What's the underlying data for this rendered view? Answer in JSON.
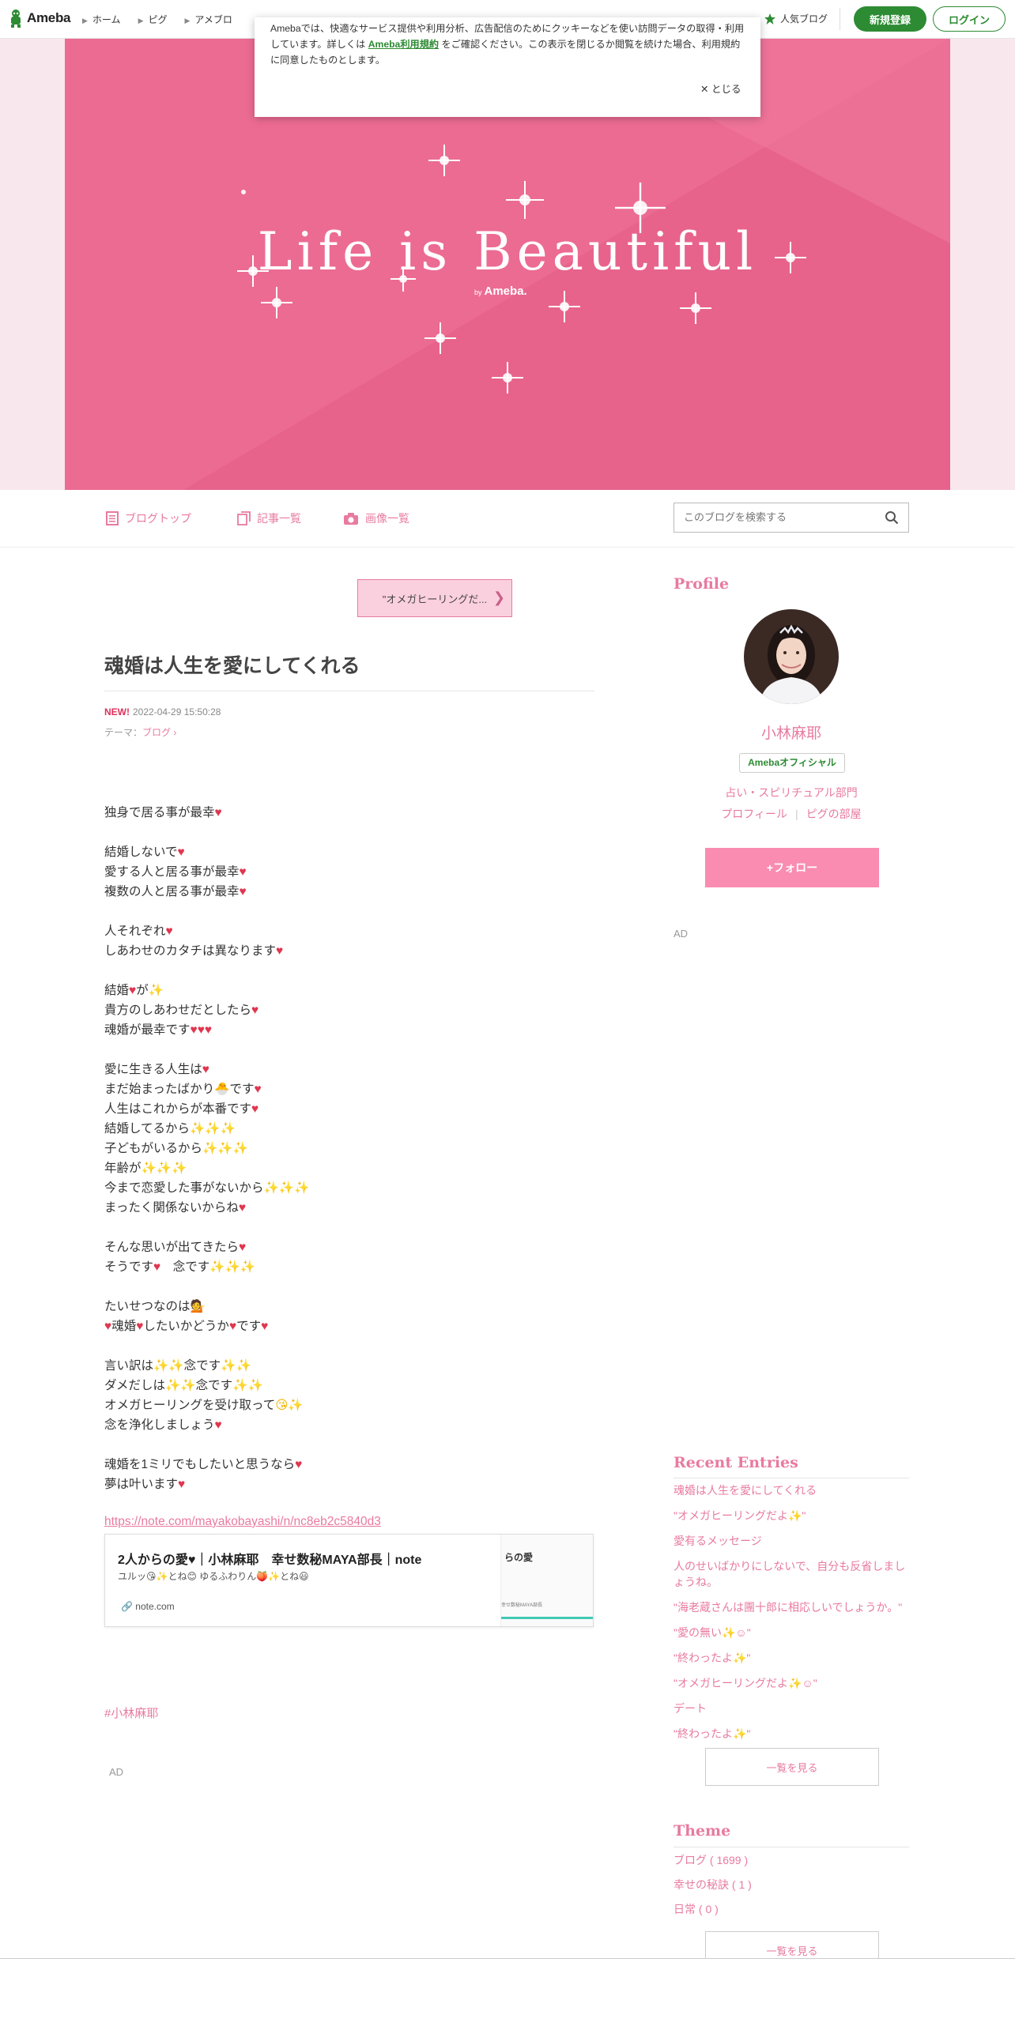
{
  "header": {
    "logo": "Ameba",
    "nav": [
      "ホーム",
      "ピグ",
      "アメブロ"
    ],
    "popular": "人気ブログ",
    "register": "新規登録",
    "login": "ログイン"
  },
  "cookie": {
    "text_before": "Amebaでは、快適なサービス提供や利用分析、広告配信のためにクッキーなどを使い訪問データの取得・利用しています。詳しくは ",
    "link": "Ameba利用規約",
    "text_after": " をご確認ください。この表示を閉じるか閲覧を続けた場合、利用規約に同意したものとします。",
    "close": "とじる"
  },
  "banner": {
    "title": "Life is Beautiful",
    "by": "by",
    "brand": "Ameba."
  },
  "subnav": {
    "blog_top": "ブログトップ",
    "entries": "記事一覧",
    "images": "画像一覧",
    "search_placeholder": "このブログを検索する"
  },
  "article": {
    "prev": "\"オメガヒーリングだ...",
    "title": "魂婚は人生を愛にしてくれる",
    "new": "NEW!",
    "date": "2022-04-29 15:50:28",
    "theme_label": "テーマ：",
    "theme": "ブログ",
    "lines": [
      [
        [
          "t",
          "独身で居る事が最幸"
        ],
        [
          "h",
          "♥"
        ]
      ],
      [],
      [
        [
          "t",
          "結婚しないで"
        ],
        [
          "h",
          "♥"
        ]
      ],
      [
        [
          "t",
          "愛する人と居る事が最幸"
        ],
        [
          "h",
          "♥"
        ]
      ],
      [
        [
          "t",
          "複数の人と居る事が最幸"
        ],
        [
          "h",
          "♥"
        ]
      ],
      [],
      [
        [
          "t",
          "人それぞれ"
        ],
        [
          "h",
          "♥"
        ]
      ],
      [
        [
          "t",
          "しあわせのカタチは異なります"
        ],
        [
          "h",
          "♥"
        ]
      ],
      [],
      [
        [
          "t",
          "結婚"
        ],
        [
          "h",
          "♥"
        ],
        [
          "t",
          "が"
        ],
        [
          "s",
          "✨"
        ]
      ],
      [
        [
          "t",
          "貴方のしあわせだとしたら"
        ],
        [
          "h",
          "♥"
        ]
      ],
      [
        [
          "t",
          "魂婚が最幸です"
        ],
        [
          "h",
          "♥♥♥"
        ]
      ],
      [],
      [
        [
          "t",
          "愛に生きる人生は"
        ],
        [
          "h",
          "♥"
        ]
      ],
      [
        [
          "t",
          "まだ始まったばかり"
        ],
        [
          "s",
          "🐣"
        ],
        [
          "t",
          "です"
        ],
        [
          "h",
          "♥"
        ]
      ],
      [
        [
          "t",
          "人生はこれからが本番です"
        ],
        [
          "h",
          "♥"
        ]
      ],
      [
        [
          "t",
          "結婚してるから"
        ],
        [
          "s",
          "✨✨✨"
        ]
      ],
      [
        [
          "t",
          "子どもがいるから"
        ],
        [
          "s",
          "✨✨✨"
        ]
      ],
      [
        [
          "t",
          "年齢が"
        ],
        [
          "s",
          "✨✨✨"
        ]
      ],
      [
        [
          "t",
          "今まで恋愛した事がないから"
        ],
        [
          "s",
          "✨✨✨"
        ]
      ],
      [
        [
          "t",
          "まったく関係ないからね"
        ],
        [
          "h",
          "♥"
        ]
      ],
      [],
      [
        [
          "t",
          "そんな思いが出てきたら"
        ],
        [
          "h",
          "♥"
        ]
      ],
      [
        [
          "t",
          "そうです"
        ],
        [
          "h",
          "♥"
        ],
        [
          "t",
          "　念です"
        ],
        [
          "s",
          "✨✨✨"
        ]
      ],
      [],
      [
        [
          "t",
          "たいせつなのは"
        ],
        [
          "s",
          "💁"
        ]
      ],
      [
        [
          "h",
          "♥"
        ],
        [
          "t",
          "魂婚"
        ],
        [
          "h",
          "♥"
        ],
        [
          "t",
          "したいかどうか"
        ],
        [
          "h",
          "♥"
        ],
        [
          "t",
          "です"
        ],
        [
          "h",
          "♥"
        ]
      ],
      [],
      [
        [
          "t",
          "言い訳は"
        ],
        [
          "s",
          "✨✨"
        ],
        [
          "t",
          "念です"
        ],
        [
          "s",
          "✨✨"
        ]
      ],
      [
        [
          "t",
          "ダメだしは"
        ],
        [
          "s",
          "✨✨"
        ],
        [
          "t",
          "念です"
        ],
        [
          "s",
          "✨✨"
        ]
      ],
      [
        [
          "t",
          "オメガヒーリングを受け取って"
        ],
        [
          "s",
          "😘✨"
        ]
      ],
      [
        [
          "t",
          "念を浄化しましょう"
        ],
        [
          "h",
          "♥"
        ]
      ],
      [],
      [
        [
          "t",
          "魂婚を1ミリでもしたいと思うなら"
        ],
        [
          "h",
          "♥"
        ]
      ],
      [
        [
          "t",
          "夢は叶います"
        ],
        [
          "h",
          "♥"
        ]
      ]
    ],
    "url": "https://note.com/mayakobayashi/n/nc8eb2c5840d3",
    "card": {
      "title": "2人からの愛♥｜小林麻耶　幸せ数秘MAYA部長｜note",
      "desc": "ユルッ😘✨とね😊 ゆるふわりん🍑✨とね😃",
      "domain": "note.com",
      "thumb_title": "らの愛",
      "thumb_sub": "幸せ数秘MAYA部長"
    },
    "hashtag": "#小林麻耶",
    "ad": "AD"
  },
  "sidebar": {
    "profile_heading": "Profile",
    "name": "小林麻耶",
    "official": "Amebaオフィシャル",
    "category": "占い・スピリチュアル部門",
    "profile_link": "プロフィール",
    "pig_link": "ピグの部屋",
    "follow": "+フォロー",
    "ad": "AD",
    "recent_heading": "Recent Entries",
    "recent": [
      "魂婚は人生を愛にしてくれる",
      "\"オメガヒーリングだよ✨\"",
      "愛有るメッセージ",
      "人のせいばかりにしないで、自分も反省しましょうね。",
      "\"海老蔵さんは團十郎に相応しいでしょうか。\"",
      "\"愛の無い✨☺\"",
      "\"終わったよ✨\"",
      "\"オメガヒーリングだよ✨☺\"",
      "デート",
      "\"終わったよ✨\""
    ],
    "recent_more": "一覧を見る",
    "theme_heading": "Theme",
    "themes": [
      "ブログ ( 1699 )",
      "幸せの秘訣 ( 1 )",
      "日常 ( 0 )"
    ],
    "theme_more": "一覧を見る"
  },
  "colors": {
    "pink": "#e87aa0",
    "banner": "#ec6b93",
    "green": "#2d8b33",
    "follow": "#f98cb0"
  }
}
